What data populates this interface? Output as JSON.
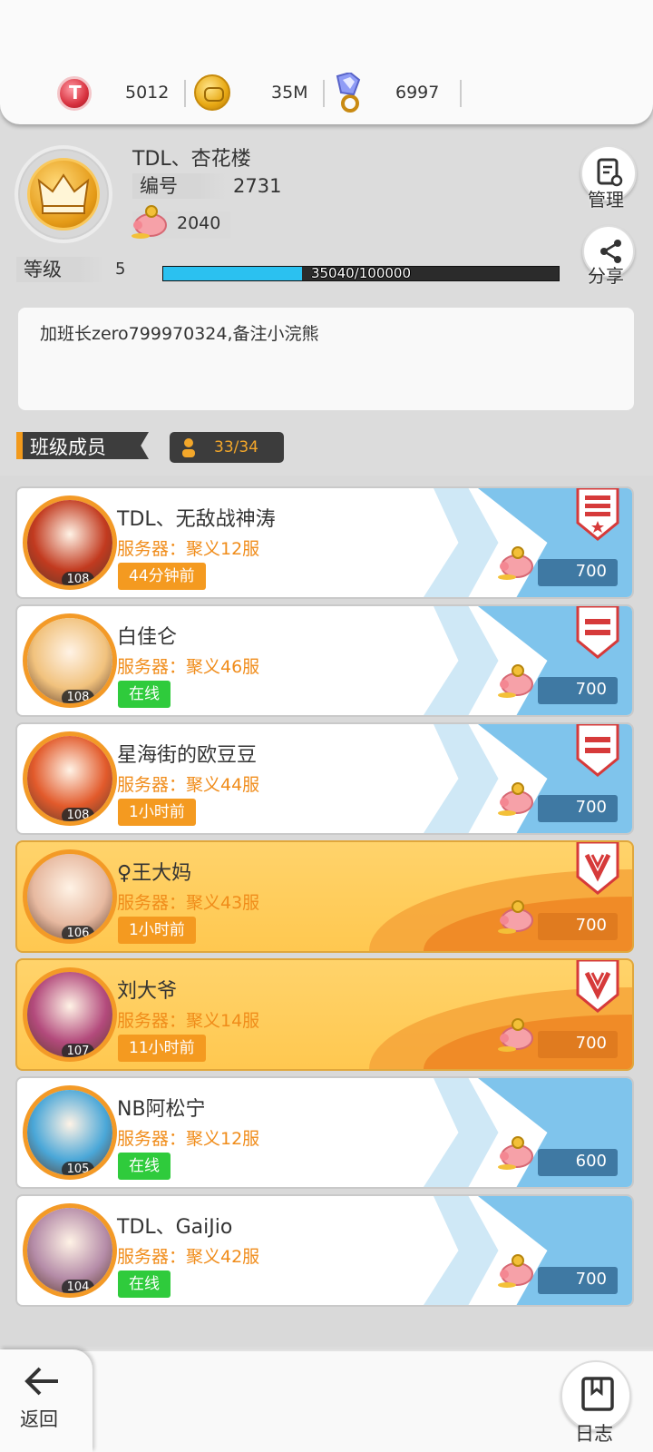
{
  "currency": {
    "tokens": "5012",
    "coins": "35M",
    "gems": "6997",
    "colors": {
      "token": "#d8323f",
      "coin": "#e8a914",
      "gem": "#7a8cf0"
    }
  },
  "club": {
    "name": "TDL、杏花楼",
    "id_label": "编号",
    "id_value": "2731",
    "funds": "2040",
    "level_label": "等级",
    "level_value": "5",
    "xp_text": "35040/100000",
    "xp_fraction": 0.3504,
    "notice": "加班长zero799970324,备注小浣熊"
  },
  "actions": {
    "manage_label": "管理",
    "share_label": "分享",
    "back_label": "返回",
    "log_label": "日志"
  },
  "members_header": {
    "title": "班级成员",
    "count": "33/34"
  },
  "members": [
    {
      "name": "TDL、无敌战神涛",
      "server": "服务器：聚义12服",
      "status": "44分钟前",
      "status_type": "time",
      "level": "108",
      "contribution": "700",
      "rank_icon": "leader-icon",
      "style": "normal",
      "avatar_color": "#c23a1f"
    },
    {
      "name": "白佳仑",
      "server": "服务器：聚义46服",
      "status": "在线",
      "status_type": "online",
      "level": "108",
      "contribution": "700",
      "rank_icon": "officer-icon",
      "style": "normal",
      "avatar_color": "#f1c27d"
    },
    {
      "name": "星海街的欧豆豆",
      "server": "服务器：聚义44服",
      "status": "1小时前",
      "status_type": "time",
      "level": "108",
      "contribution": "700",
      "rank_icon": "officer-icon",
      "style": "normal",
      "avatar_color": "#e25a2b"
    },
    {
      "name": "♀王大妈",
      "server": "服务器：聚义43服",
      "status": "1小时前",
      "status_type": "time",
      "level": "106",
      "contribution": "700",
      "rank_icon": "elite-icon",
      "style": "gold",
      "avatar_color": "#e7b9a0"
    },
    {
      "name": "刘大爷",
      "server": "服务器：聚义14服",
      "status": "11小时前",
      "status_type": "time",
      "level": "107",
      "contribution": "700",
      "rank_icon": "elite-icon",
      "style": "gold",
      "avatar_color": "#b34a7c"
    },
    {
      "name": "NB阿松宁",
      "server": "服务器：聚义12服",
      "status": "在线",
      "status_type": "online",
      "level": "105",
      "contribution": "600",
      "rank_icon": "",
      "style": "normal",
      "avatar_color": "#4aa7d8"
    },
    {
      "name": "TDL、GaiJio",
      "server": "服务器：聚义42服",
      "status": "在线",
      "status_type": "online",
      "level": "104",
      "contribution": "700",
      "rank_icon": "",
      "style": "normal",
      "avatar_color": "#b58ca8"
    }
  ]
}
